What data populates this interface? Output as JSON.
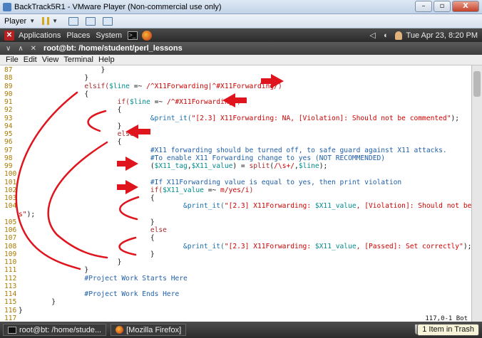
{
  "vm_window": {
    "title": "BackTrack5R1 - VMware Player (Non-commercial use only)",
    "controls": [
      "–",
      "▫",
      "X"
    ]
  },
  "vm_toolbar": {
    "player_label": "Player"
  },
  "gnome_panel": {
    "menus": [
      "Applications",
      "Places",
      "System"
    ],
    "clock": "Tue Apr 23,  8:20 PM"
  },
  "terminal": {
    "title": "root@bt: /home/student/perl_lessons",
    "menu": [
      "File",
      "Edit",
      "View",
      "Terminal",
      "Help"
    ],
    "status": "117,0-1        Bot",
    "lines": [
      {
        "n": "87",
        "segs": [
          {
            "t": "                    }",
            "c": "o"
          }
        ]
      },
      {
        "n": "88",
        "segs": [
          {
            "t": "                }",
            "c": "o"
          }
        ]
      },
      {
        "n": "89",
        "segs": [
          {
            "t": "                elsif(",
            "c": "k"
          },
          {
            "t": "$line",
            "c": "v"
          },
          {
            "t": " =~ ",
            "c": "o"
          },
          {
            "t": "/^X11Forwarding|^#X11Forwarding/",
            "c": "s"
          },
          {
            "t": ")",
            "c": "k"
          }
        ]
      },
      {
        "n": "90",
        "segs": [
          {
            "t": "                {",
            "c": "o"
          }
        ]
      },
      {
        "n": "91",
        "segs": [
          {
            "t": "                        if(",
            "c": "k"
          },
          {
            "t": "$line",
            "c": "v"
          },
          {
            "t": " =~ ",
            "c": "o"
          },
          {
            "t": "/^#X11Forwarding/",
            "c": "s"
          },
          {
            "t": ")",
            "c": "k"
          }
        ]
      },
      {
        "n": "92",
        "segs": [
          {
            "t": "                        {",
            "c": "o"
          }
        ]
      },
      {
        "n": "93",
        "segs": [
          {
            "t": "                                &print_it(",
            "c": "f"
          },
          {
            "t": "\"[2.3] X11Forwarding: NA, [Violation]: Should not be commented\"",
            "c": "s"
          },
          {
            "t": ");",
            "c": "o"
          }
        ]
      },
      {
        "n": "94",
        "segs": [
          {
            "t": "                        }",
            "c": "o"
          }
        ]
      },
      {
        "n": "95",
        "segs": [
          {
            "t": "                        else",
            "c": "k"
          }
        ]
      },
      {
        "n": "96",
        "segs": [
          {
            "t": "                        {",
            "c": "o"
          }
        ]
      },
      {
        "n": "97",
        "segs": [
          {
            "t": "                                #X11 forwarding should be turned off, to safe guard against X11 attacks.",
            "c": "c"
          }
        ]
      },
      {
        "n": "98",
        "segs": [
          {
            "t": "                                #To enable X11 Forwarding change to yes (NOT RECOMMENDED)",
            "c": "c"
          }
        ]
      },
      {
        "n": "99",
        "segs": [
          {
            "t": "                                (",
            "c": "o"
          },
          {
            "t": "$X11_tag",
            "c": "v"
          },
          {
            "t": ",",
            "c": "o"
          },
          {
            "t": "$X11_value",
            "c": "v"
          },
          {
            "t": ") = ",
            "c": "o"
          },
          {
            "t": "split",
            "c": "k"
          },
          {
            "t": "(",
            "c": "o"
          },
          {
            "t": "/\\s+/",
            "c": "s"
          },
          {
            "t": ",",
            "c": "o"
          },
          {
            "t": "$line",
            "c": "v"
          },
          {
            "t": ");",
            "c": "o"
          }
        ]
      },
      {
        "n": "100",
        "segs": [
          {
            "t": "",
            "c": "o"
          }
        ]
      },
      {
        "n": "101",
        "segs": [
          {
            "t": "                                #If X11Forwarding value is equal to yes, then print violation",
            "c": "c"
          }
        ]
      },
      {
        "n": "102",
        "segs": [
          {
            "t": "                                if(",
            "c": "k"
          },
          {
            "t": "$X11_value",
            "c": "v"
          },
          {
            "t": " =~ ",
            "c": "o"
          },
          {
            "t": "m/yes/i",
            "c": "s"
          },
          {
            "t": ")",
            "c": "k"
          }
        ]
      },
      {
        "n": "103",
        "segs": [
          {
            "t": "                                {",
            "c": "o"
          }
        ]
      },
      {
        "n": "104",
        "segs": [
          {
            "t": "                                        &print_it(",
            "c": "f"
          },
          {
            "t": "\"[2.3] X11Forwarding: ",
            "c": "s"
          },
          {
            "t": "$X11_value",
            "c": "v"
          },
          {
            "t": ", [Violation]: Should not be set to ye",
            "c": "s"
          }
        ]
      },
      {
        "n": "",
        "segs": [
          {
            "t": "s\"",
            "c": "s"
          },
          {
            "t": ");",
            "c": "o"
          }
        ]
      },
      {
        "n": "105",
        "segs": [
          {
            "t": "                                }",
            "c": "o"
          }
        ]
      },
      {
        "n": "106",
        "segs": [
          {
            "t": "                                else",
            "c": "k"
          }
        ]
      },
      {
        "n": "107",
        "segs": [
          {
            "t": "                                {",
            "c": "o"
          }
        ]
      },
      {
        "n": "108",
        "segs": [
          {
            "t": "                                        &print_it(",
            "c": "f"
          },
          {
            "t": "\"[2.3] X11Forwarding: ",
            "c": "s"
          },
          {
            "t": "$X11_value",
            "c": "v"
          },
          {
            "t": ", [Passed]: Set correctly\"",
            "c": "s"
          },
          {
            "t": ");",
            "c": "o"
          }
        ]
      },
      {
        "n": "109",
        "segs": [
          {
            "t": "                                }",
            "c": "o"
          }
        ]
      },
      {
        "n": "110",
        "segs": [
          {
            "t": "                        }",
            "c": "o"
          }
        ]
      },
      {
        "n": "111",
        "segs": [
          {
            "t": "                }",
            "c": "o"
          }
        ]
      },
      {
        "n": "112",
        "segs": [
          {
            "t": "                #Project Work Starts Here",
            "c": "c"
          }
        ]
      },
      {
        "n": "113",
        "segs": [
          {
            "t": "",
            "c": "o"
          }
        ]
      },
      {
        "n": "114",
        "segs": [
          {
            "t": "                #Project Work Ends Here",
            "c": "c"
          }
        ]
      },
      {
        "n": "115",
        "segs": [
          {
            "t": "        }",
            "c": "o"
          }
        ]
      },
      {
        "n": "116",
        "segs": [
          {
            "t": "}",
            "c": "o"
          }
        ]
      },
      {
        "n": "117",
        "segs": [
          {
            "t": "",
            "c": "o"
          }
        ]
      }
    ]
  },
  "taskbar": {
    "items": [
      "root@bt: /home/stude...",
      "[Mozilla Firefox]"
    ],
    "trash": "1 Item in Trash"
  },
  "colors": {
    "annotation_red": "#e0141c",
    "keyword": "#a52a2a",
    "string": "#cc0000",
    "variable": "#008b8b",
    "comment": "#1f5fa8"
  }
}
